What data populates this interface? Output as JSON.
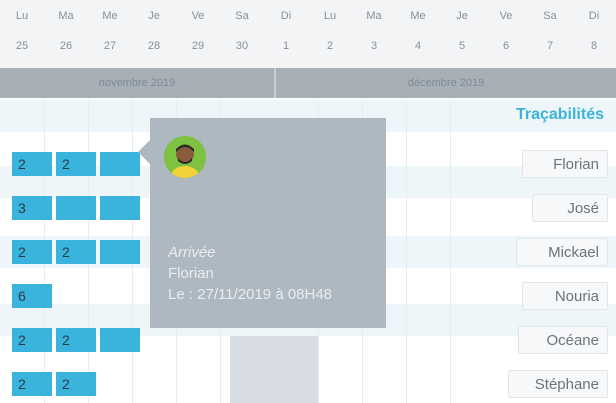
{
  "calendar": {
    "day_names": [
      "Lu",
      "Ma",
      "Me",
      "Je",
      "Ve",
      "Sa",
      "Di",
      "Lu",
      "Ma",
      "Me",
      "Je",
      "Ve",
      "Sa",
      "Di"
    ],
    "day_numbers": [
      "25",
      "26",
      "27",
      "28",
      "29",
      "30",
      "1",
      "2",
      "3",
      "4",
      "5",
      "6",
      "7",
      "8"
    ],
    "months": {
      "nov": "novembre 2019",
      "dec": "décembre 2019"
    }
  },
  "tracabilites_label": "Traçabilités",
  "rows": [
    {
      "name": "Florian",
      "cells": [
        "2",
        "2",
        ""
      ]
    },
    {
      "name": "José",
      "cells": [
        "3",
        "",
        ""
      ]
    },
    {
      "name": "Mickael",
      "cells": [
        "2",
        "2",
        ""
      ]
    },
    {
      "name": "Nouria",
      "cells": [
        "6"
      ]
    },
    {
      "name": "Océane",
      "cells": [
        "2",
        "2",
        ""
      ]
    },
    {
      "name": "Stéphane",
      "cells": [
        "2",
        "2"
      ]
    }
  ],
  "popup": {
    "title": "Arrivée",
    "person": "Florian",
    "datetime": "Le : 27/11/2019 à 08H48"
  }
}
